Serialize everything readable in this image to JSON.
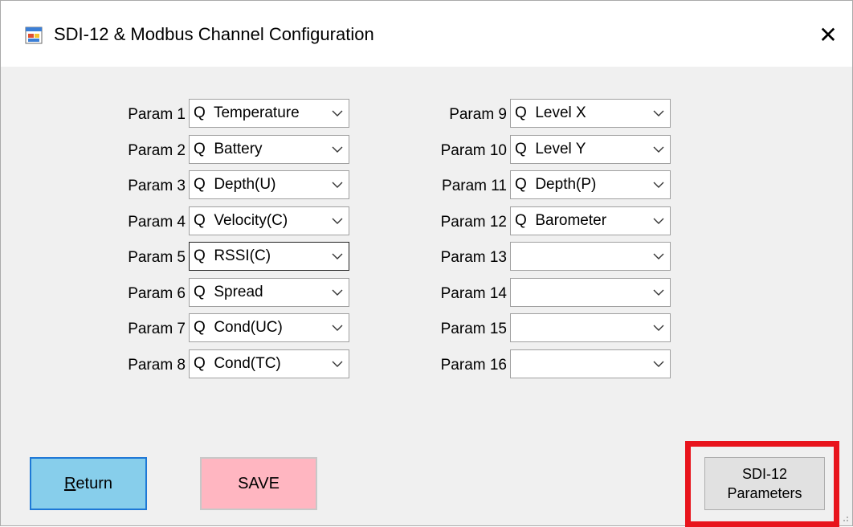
{
  "window": {
    "title": "SDI-12 & Modbus Channel Configuration",
    "close_label": "✕"
  },
  "params_left": [
    {
      "label": "Param 1",
      "value": "Q  Temperature"
    },
    {
      "label": "Param 2",
      "value": "Q  Battery"
    },
    {
      "label": "Param 3",
      "value": "Q  Depth(U)"
    },
    {
      "label": "Param 4",
      "value": "Q  Velocity(C)"
    },
    {
      "label": "Param 5",
      "value": "Q  RSSI(C)"
    },
    {
      "label": "Param 6",
      "value": "Q  Spread"
    },
    {
      "label": "Param 7",
      "value": "Q  Cond(UC)"
    },
    {
      "label": "Param 8",
      "value": "Q  Cond(TC)"
    }
  ],
  "params_right": [
    {
      "label": "Param 9",
      "value": "Q  Level X"
    },
    {
      "label": "Param 10",
      "value": "Q  Level Y"
    },
    {
      "label": "Param 11",
      "value": "Q  Depth(P)"
    },
    {
      "label": "Param 12",
      "value": "Q  Barometer"
    },
    {
      "label": "Param 13",
      "value": ""
    },
    {
      "label": "Param 14",
      "value": ""
    },
    {
      "label": "Param 15",
      "value": ""
    },
    {
      "label": "Param 16",
      "value": ""
    }
  ],
  "buttons": {
    "return_first": "R",
    "return_rest": "eturn",
    "save": "SAVE",
    "sdi_line1": "SDI-12",
    "sdi_line2": "Parameters"
  },
  "colors": {
    "return_bg": "#87ceeb",
    "save_bg": "#ffb6c1",
    "highlight": "#e8141c"
  }
}
